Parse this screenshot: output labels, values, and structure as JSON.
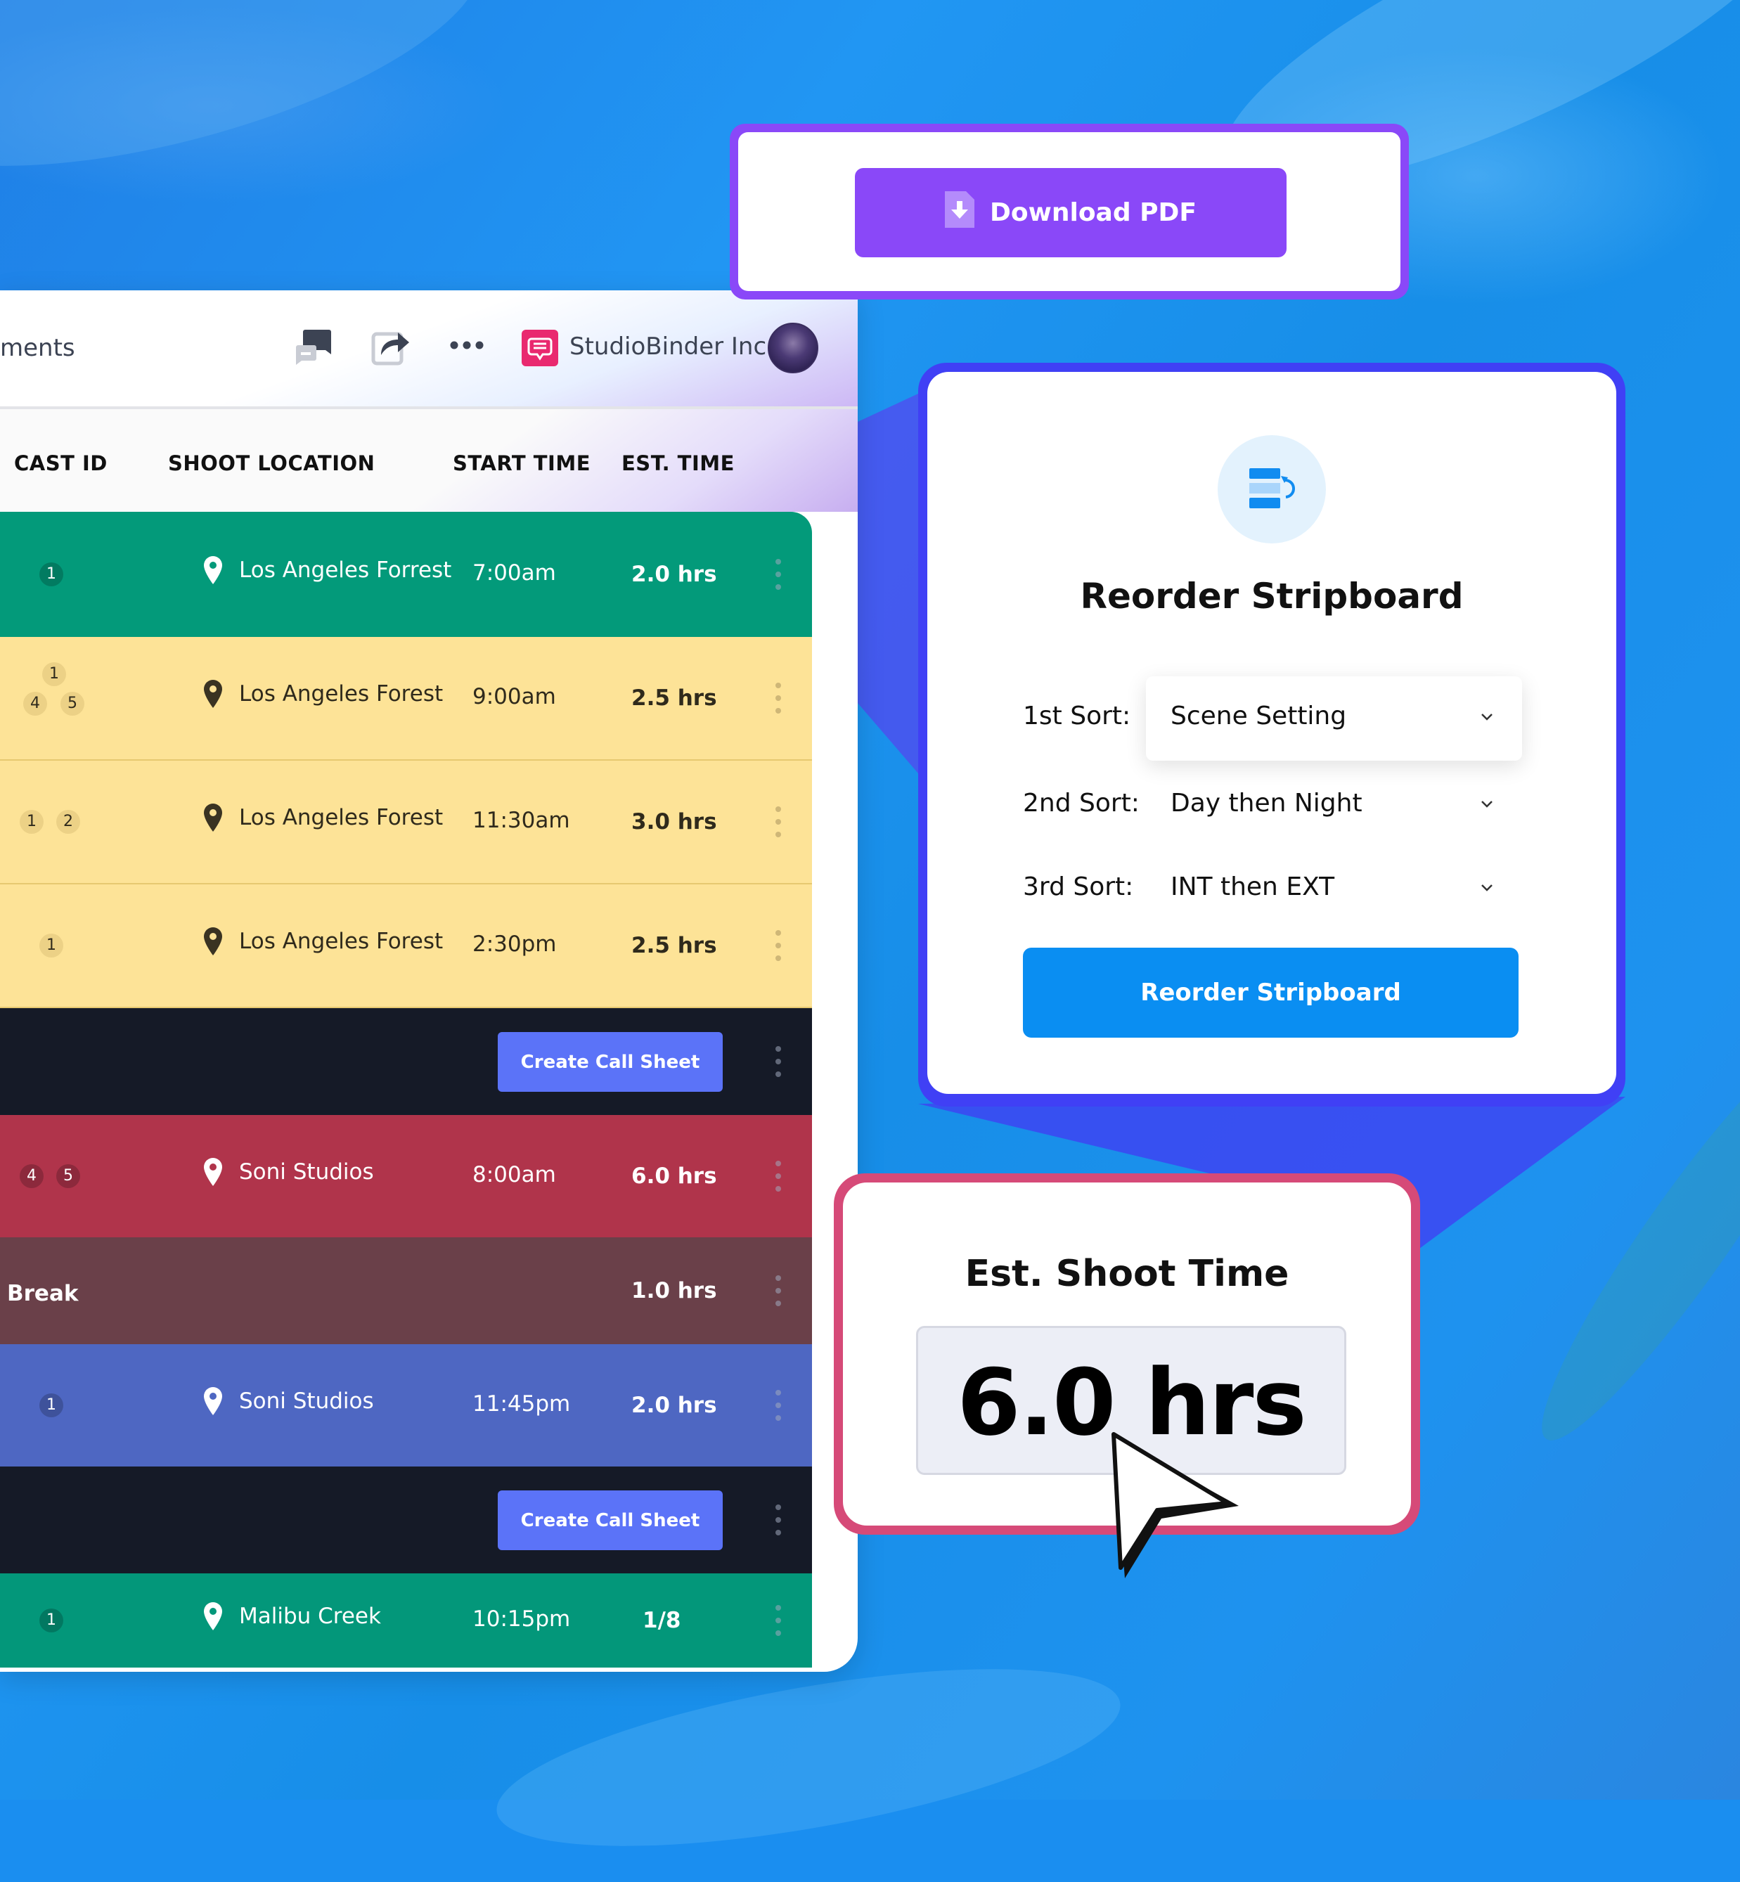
{
  "header": {
    "breadcrumb_fragment": "ments",
    "org_name": "StudioBinder Inc",
    "icons": [
      "comments-icon",
      "share-icon",
      "more-icon",
      "org-logo-icon",
      "avatar"
    ]
  },
  "table": {
    "columns": [
      "CAST ID",
      "SHOOT LOCATION",
      "START TIME",
      "EST. TIME"
    ],
    "rows": [
      {
        "type": "strip",
        "color": "#039a7a",
        "text_color": "#ffffff",
        "cast_ids": [
          "1"
        ],
        "location": "Los Angeles Forrest",
        "start": "7:00am",
        "est": "2.0 hrs"
      },
      {
        "type": "strip",
        "color": "#fde397",
        "text_color": "#2f2a1c",
        "cast_ids": [
          "1",
          "4",
          "5"
        ],
        "location": "Los Angeles Forest",
        "start": "9:00am",
        "est": "2.5 hrs"
      },
      {
        "type": "strip",
        "color": "#fde397",
        "text_color": "#2f2a1c",
        "cast_ids": [
          "1",
          "2"
        ],
        "location": "Los Angeles Forest",
        "start": "11:30am",
        "est": "3.0 hrs"
      },
      {
        "type": "strip",
        "color": "#fde397",
        "text_color": "#2f2a1c",
        "cast_ids": [
          "1"
        ],
        "location": "Los Angeles Forest",
        "start": "2:30pm",
        "est": "2.5 hrs"
      },
      {
        "type": "day-break",
        "color": "#151a27",
        "button_label": "Create Call Sheet"
      },
      {
        "type": "strip",
        "color": "#b0344b",
        "text_color": "#ffffff",
        "cast_ids": [
          "4",
          "5"
        ],
        "location": "Soni Studios",
        "start": "8:00am",
        "est": "6.0 hrs"
      },
      {
        "type": "break",
        "color": "#6a4049",
        "text_color": "#ffffff",
        "label": "Break",
        "est": "1.0 hrs"
      },
      {
        "type": "strip",
        "color": "#4e67c2",
        "text_color": "#ffffff",
        "cast_ids": [
          "1"
        ],
        "location": "Soni Studios",
        "start": "11:45pm",
        "est": "2.0 hrs"
      },
      {
        "type": "day-break",
        "color": "#151a27",
        "button_label": "Create Call Sheet"
      },
      {
        "type": "strip",
        "color": "#03977a",
        "text_color": "#ffffff",
        "cast_ids": [
          "1"
        ],
        "location": "Malibu Creek",
        "start": "10:15pm",
        "est": "1/8"
      }
    ]
  },
  "download": {
    "button_label": "Download PDF",
    "accent": "#8a48f8"
  },
  "reorder": {
    "title": "Reorder Stripboard",
    "sorts": [
      {
        "label": "1st Sort:",
        "value": "Scene Setting"
      },
      {
        "label": "2nd Sort:",
        "value": "Day then Night"
      },
      {
        "label": "3rd Sort:",
        "value": "INT then EXT"
      }
    ],
    "button_label": "Reorder Stripboard",
    "accent": "#0a8ef2",
    "border": "#4040f5"
  },
  "estimate": {
    "title": "Est. Shoot Time",
    "value": "6.0 hrs",
    "border": "#d64a78"
  }
}
